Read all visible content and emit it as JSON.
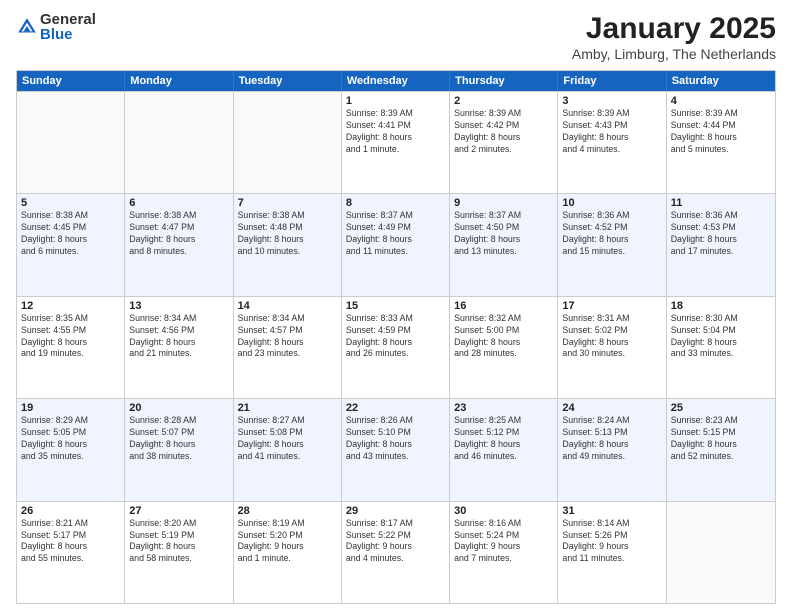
{
  "logo": {
    "general": "General",
    "blue": "Blue"
  },
  "title": "January 2025",
  "location": "Amby, Limburg, The Netherlands",
  "days": [
    "Sunday",
    "Monday",
    "Tuesday",
    "Wednesday",
    "Thursday",
    "Friday",
    "Saturday"
  ],
  "rows": [
    [
      {
        "date": "",
        "info": ""
      },
      {
        "date": "",
        "info": ""
      },
      {
        "date": "",
        "info": ""
      },
      {
        "date": "1",
        "info": "Sunrise: 8:39 AM\nSunset: 4:41 PM\nDaylight: 8 hours\nand 1 minute."
      },
      {
        "date": "2",
        "info": "Sunrise: 8:39 AM\nSunset: 4:42 PM\nDaylight: 8 hours\nand 2 minutes."
      },
      {
        "date": "3",
        "info": "Sunrise: 8:39 AM\nSunset: 4:43 PM\nDaylight: 8 hours\nand 4 minutes."
      },
      {
        "date": "4",
        "info": "Sunrise: 8:39 AM\nSunset: 4:44 PM\nDaylight: 8 hours\nand 5 minutes."
      }
    ],
    [
      {
        "date": "5",
        "info": "Sunrise: 8:38 AM\nSunset: 4:45 PM\nDaylight: 8 hours\nand 6 minutes."
      },
      {
        "date": "6",
        "info": "Sunrise: 8:38 AM\nSunset: 4:47 PM\nDaylight: 8 hours\nand 8 minutes."
      },
      {
        "date": "7",
        "info": "Sunrise: 8:38 AM\nSunset: 4:48 PM\nDaylight: 8 hours\nand 10 minutes."
      },
      {
        "date": "8",
        "info": "Sunrise: 8:37 AM\nSunset: 4:49 PM\nDaylight: 8 hours\nand 11 minutes."
      },
      {
        "date": "9",
        "info": "Sunrise: 8:37 AM\nSunset: 4:50 PM\nDaylight: 8 hours\nand 13 minutes."
      },
      {
        "date": "10",
        "info": "Sunrise: 8:36 AM\nSunset: 4:52 PM\nDaylight: 8 hours\nand 15 minutes."
      },
      {
        "date": "11",
        "info": "Sunrise: 8:36 AM\nSunset: 4:53 PM\nDaylight: 8 hours\nand 17 minutes."
      }
    ],
    [
      {
        "date": "12",
        "info": "Sunrise: 8:35 AM\nSunset: 4:55 PM\nDaylight: 8 hours\nand 19 minutes."
      },
      {
        "date": "13",
        "info": "Sunrise: 8:34 AM\nSunset: 4:56 PM\nDaylight: 8 hours\nand 21 minutes."
      },
      {
        "date": "14",
        "info": "Sunrise: 8:34 AM\nSunset: 4:57 PM\nDaylight: 8 hours\nand 23 minutes."
      },
      {
        "date": "15",
        "info": "Sunrise: 8:33 AM\nSunset: 4:59 PM\nDaylight: 8 hours\nand 26 minutes."
      },
      {
        "date": "16",
        "info": "Sunrise: 8:32 AM\nSunset: 5:00 PM\nDaylight: 8 hours\nand 28 minutes."
      },
      {
        "date": "17",
        "info": "Sunrise: 8:31 AM\nSunset: 5:02 PM\nDaylight: 8 hours\nand 30 minutes."
      },
      {
        "date": "18",
        "info": "Sunrise: 8:30 AM\nSunset: 5:04 PM\nDaylight: 8 hours\nand 33 minutes."
      }
    ],
    [
      {
        "date": "19",
        "info": "Sunrise: 8:29 AM\nSunset: 5:05 PM\nDaylight: 8 hours\nand 35 minutes."
      },
      {
        "date": "20",
        "info": "Sunrise: 8:28 AM\nSunset: 5:07 PM\nDaylight: 8 hours\nand 38 minutes."
      },
      {
        "date": "21",
        "info": "Sunrise: 8:27 AM\nSunset: 5:08 PM\nDaylight: 8 hours\nand 41 minutes."
      },
      {
        "date": "22",
        "info": "Sunrise: 8:26 AM\nSunset: 5:10 PM\nDaylight: 8 hours\nand 43 minutes."
      },
      {
        "date": "23",
        "info": "Sunrise: 8:25 AM\nSunset: 5:12 PM\nDaylight: 8 hours\nand 46 minutes."
      },
      {
        "date": "24",
        "info": "Sunrise: 8:24 AM\nSunset: 5:13 PM\nDaylight: 8 hours\nand 49 minutes."
      },
      {
        "date": "25",
        "info": "Sunrise: 8:23 AM\nSunset: 5:15 PM\nDaylight: 8 hours\nand 52 minutes."
      }
    ],
    [
      {
        "date": "26",
        "info": "Sunrise: 8:21 AM\nSunset: 5:17 PM\nDaylight: 8 hours\nand 55 minutes."
      },
      {
        "date": "27",
        "info": "Sunrise: 8:20 AM\nSunset: 5:19 PM\nDaylight: 8 hours\nand 58 minutes."
      },
      {
        "date": "28",
        "info": "Sunrise: 8:19 AM\nSunset: 5:20 PM\nDaylight: 9 hours\nand 1 minute."
      },
      {
        "date": "29",
        "info": "Sunrise: 8:17 AM\nSunset: 5:22 PM\nDaylight: 9 hours\nand 4 minutes."
      },
      {
        "date": "30",
        "info": "Sunrise: 8:16 AM\nSunset: 5:24 PM\nDaylight: 9 hours\nand 7 minutes."
      },
      {
        "date": "31",
        "info": "Sunrise: 8:14 AM\nSunset: 5:26 PM\nDaylight: 9 hours\nand 11 minutes."
      },
      {
        "date": "",
        "info": ""
      }
    ]
  ]
}
